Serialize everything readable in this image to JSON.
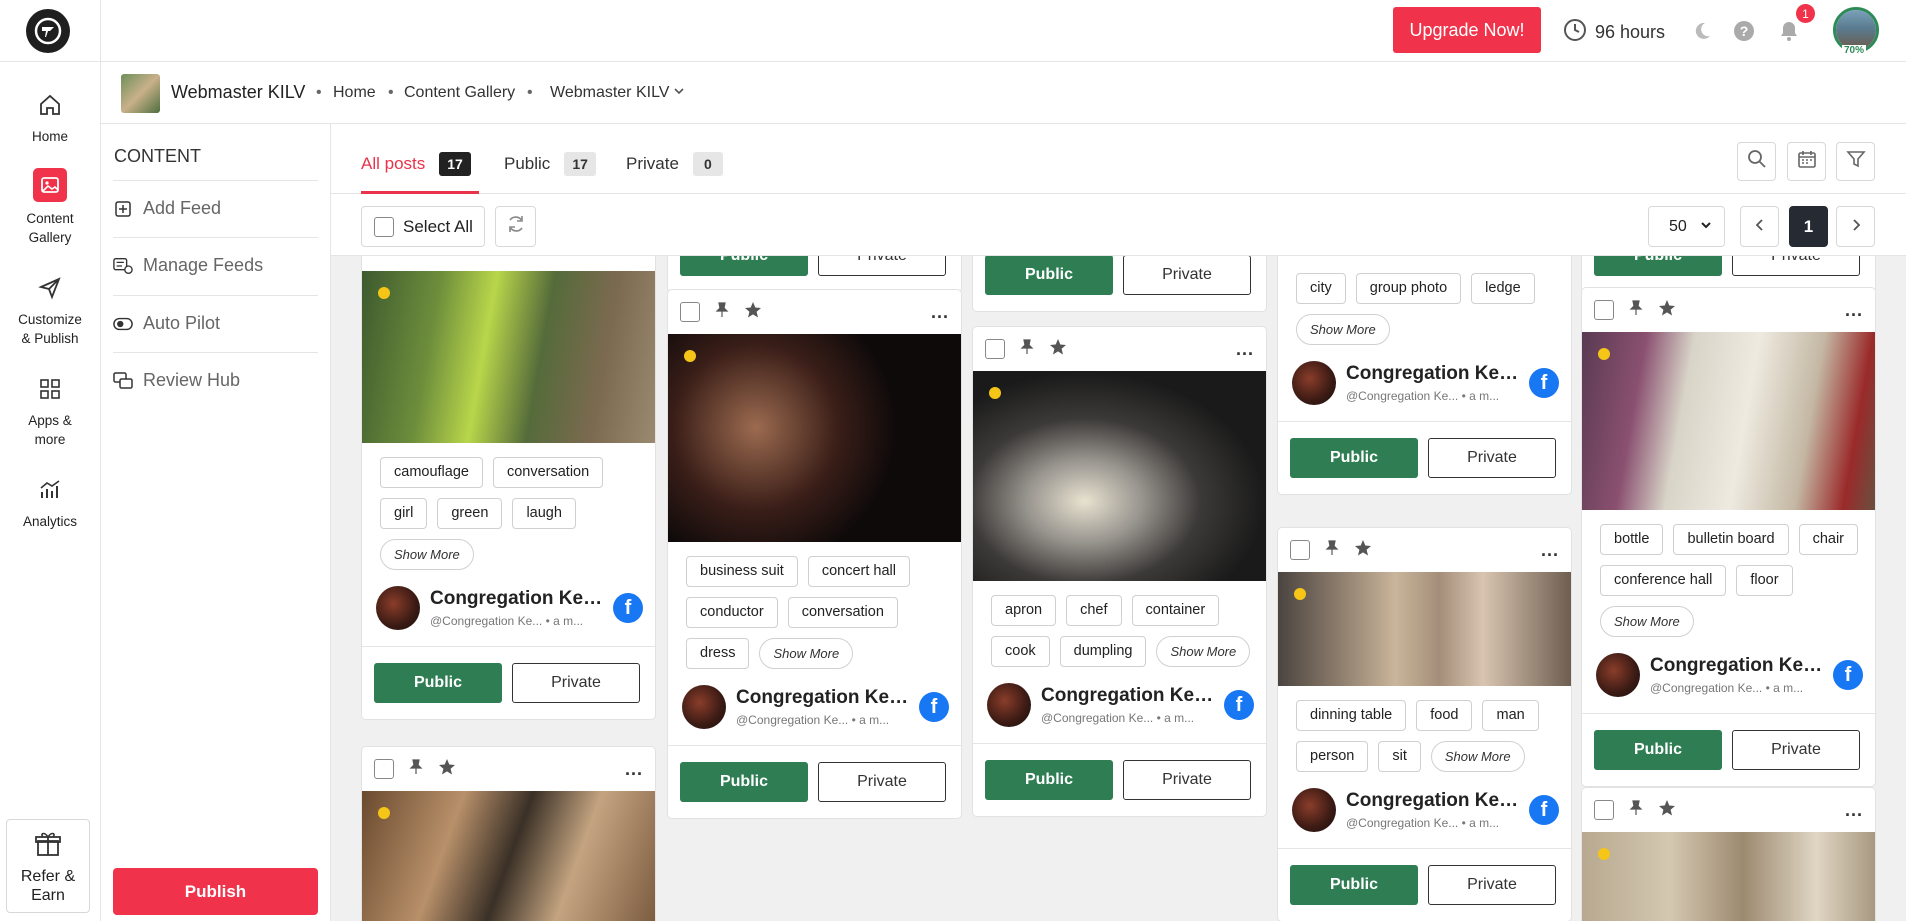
{
  "topbar": {
    "upgrade_label": "Upgrade Now!",
    "hours_label": "96 hours",
    "notif_count": "1",
    "profile_pct": "70%"
  },
  "nav": {
    "items": [
      {
        "label": "Home",
        "icon": "home-icon"
      },
      {
        "label": "Content Gallery",
        "icon": "gallery-icon"
      },
      {
        "label": "Customize & Publish",
        "icon": "send-icon"
      },
      {
        "label": "Apps & more",
        "icon": "apps-icon"
      },
      {
        "label": "Analytics",
        "icon": "analytics-icon"
      }
    ],
    "refer_label": "Refer & Earn"
  },
  "breadcrumb": {
    "title": "Webmaster KILV",
    "home": "Home",
    "gallery": "Content Gallery",
    "workspace": "Webmaster KILV"
  },
  "content_panel": {
    "heading": "CONTENT",
    "items": [
      "Add Feed",
      "Manage Feeds",
      "Auto Pilot",
      "Review Hub"
    ],
    "publish_label": "Publish"
  },
  "tabs": [
    {
      "label": "All posts",
      "count": "17"
    },
    {
      "label": "Public",
      "count": "17"
    },
    {
      "label": "Private",
      "count": "0"
    }
  ],
  "toolbar": {
    "select_all": "Select All",
    "per_page": "50",
    "page": "1"
  },
  "card_common": {
    "author_name": "Congregation Ken...",
    "author_handle": "@Congregation Ke...",
    "author_time": "• a m...",
    "public_label": "Public",
    "private_label": "Private",
    "show_more": "Show More",
    "more": "..."
  },
  "cards": [
    {
      "tags": [
        "camouflage",
        "conversation",
        "girl",
        "green",
        "laugh"
      ]
    },
    {
      "tags": [
        "business suit",
        "concert hall",
        "conductor",
        "conversation",
        "dress"
      ]
    },
    {
      "tags": [
        "apron",
        "chef",
        "container",
        "cook",
        "dumpling"
      ]
    },
    {
      "tags": [
        "city",
        "group photo",
        "ledge"
      ]
    },
    {
      "tags": [
        "dinning table",
        "food",
        "man",
        "person",
        "sit"
      ]
    },
    {
      "tags": [
        "bottle",
        "bulletin board",
        "chair",
        "conference hall",
        "floor"
      ]
    }
  ],
  "colors": {
    "accent": "#f0334a",
    "public_btn": "#2e7d53",
    "facebook": "#1877f2"
  }
}
